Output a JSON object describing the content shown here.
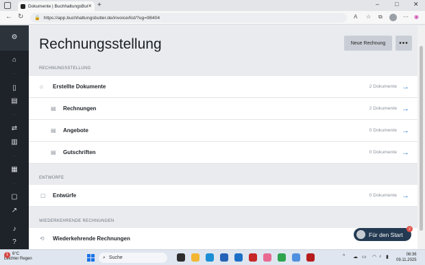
{
  "browser": {
    "tab_title": "Dokumente | BuchhaltungsButler",
    "url": "https://app.buchhaltungsbutler.de/invoice/list/?ug=98404"
  },
  "page": {
    "title": "Rechnungsstellung",
    "new_invoice_label": "Neue Rechnung",
    "more_label": "•••"
  },
  "sections": {
    "rechnungsstellung": {
      "label": "RECHNUNGSSTELLUNG",
      "rows": [
        {
          "label": "Erstellte Dokumente",
          "count": "2 Dokumente"
        },
        {
          "label": "Rechnungen",
          "count": "2 Dokumente"
        },
        {
          "label": "Angebote",
          "count": "0 Dokumente"
        },
        {
          "label": "Gutschriften",
          "count": "0 Dokumente"
        }
      ]
    },
    "entwuerfe": {
      "label": "ENTWÜRFE",
      "rows": [
        {
          "label": "Entwürfe",
          "count": "0 Dokumente"
        }
      ]
    },
    "wiederkehrend": {
      "label": "WIEDERKEHRENDE RECHNUNGEN",
      "rows": [
        {
          "label": "Wiederkehrende Rechnungen",
          "count": ""
        }
      ]
    }
  },
  "onboarding": {
    "label": "Für den Start",
    "badge": "2"
  },
  "taskbar": {
    "temperature": "6°C",
    "weather": "Leichter Regen",
    "weather_badge": "1",
    "search_placeholder": "Suche",
    "time": "08:36",
    "date": "09.11.2025"
  },
  "colors": {
    "sidebar": "#1e2329",
    "accent_arrow": "#2f7fd1",
    "onboarding_bg": "#243a52"
  }
}
